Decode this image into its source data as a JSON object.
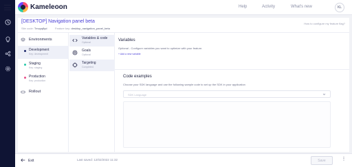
{
  "topbar": {
    "brand": "Kameleoon",
    "nav": [
      "Help",
      "Activity",
      "What's new"
    ],
    "avatar_initials": "KL"
  },
  "header": {
    "title": "[DESKTOP] Navigation panel beta",
    "site_code_label": "Site code:",
    "site_code": "Tmuyq8yd",
    "feature_key_label": "Feature key:",
    "feature_key": "desktop_navigation_panel_beta",
    "help_link": "How to configure my feature flag?"
  },
  "environments": {
    "heading": "Environments",
    "items": [
      {
        "name": "Development",
        "sub": "Key: development",
        "color": "#1f2a6b",
        "active": true
      },
      {
        "name": "Staging",
        "sub": "Key: staging",
        "color": "#26c9a8",
        "active": false
      },
      {
        "name": "Production",
        "sub": "Key: production",
        "color": "#e84f8a",
        "active": false
      }
    ],
    "rollout_label": "Rollout"
  },
  "steps": [
    {
      "name": "Variables & code",
      "sub": "Optional",
      "icon": "code-icon"
    },
    {
      "name": "Goals",
      "sub": "Optional",
      "icon": "target-icon"
    },
    {
      "name": "Targeting",
      "sub": "Completed",
      "icon": "crosshair-icon"
    }
  ],
  "variables": {
    "title": "Variables",
    "description": "Optional - Configure variables you want to optimize with your feature.",
    "add_link": "Add a new variable"
  },
  "code_examples": {
    "title": "Code examples",
    "description": "Choose your SDK language and use the following sample code to set up the SDK in your application",
    "select_placeholder": "SDK Language"
  },
  "footer": {
    "exit_label": "Exit",
    "saved_text": "Last saved: 12/02/2022 11:32",
    "save_label": "Save",
    "more_glyph": "⋮"
  },
  "colors": {
    "rail": "#0f1434",
    "accent": "#4a3fd6"
  }
}
